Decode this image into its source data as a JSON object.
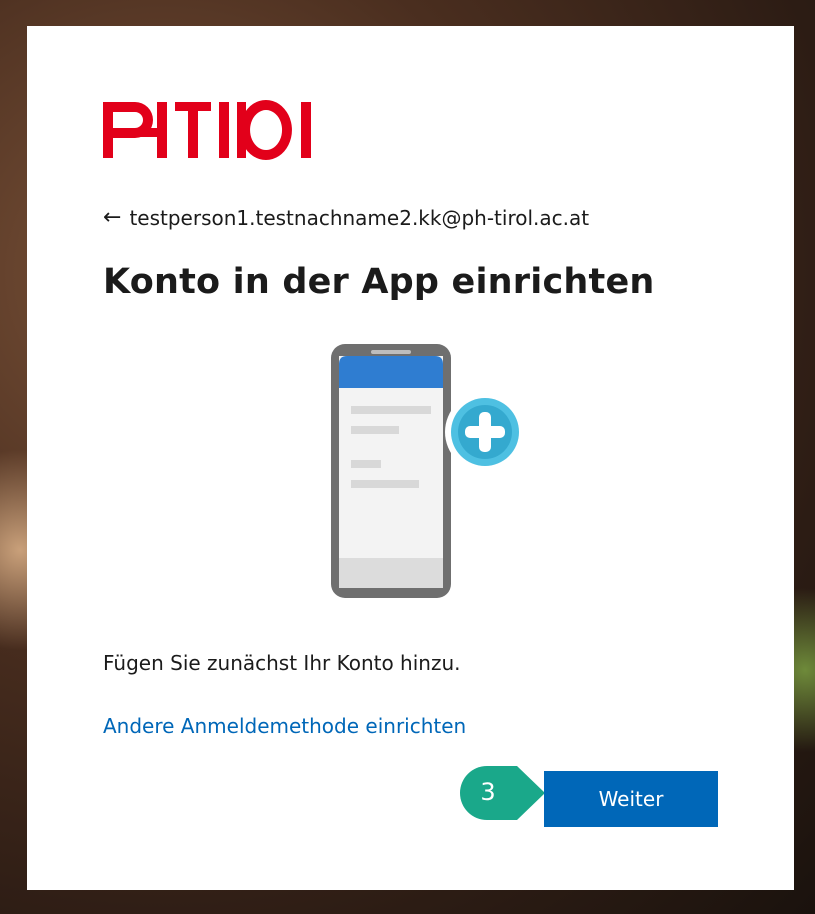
{
  "logo": {
    "alt": "PH Tirol",
    "color": "#e2001a"
  },
  "account": {
    "email": "testperson1.testnachname2.kk@ph-tirol.ac.at",
    "back_icon": "arrow-left-icon"
  },
  "page": {
    "title": "Konto in der App einrichten",
    "description": "Fügen Sie zunächst Ihr Konto hinzu.",
    "alt_method_link": "Andere Anmeldemethode einrichten"
  },
  "actions": {
    "next_label": "Weiter"
  },
  "annotation": {
    "step_number": "3",
    "color": "#1aa88a"
  },
  "colors": {
    "accent": "#0067b8",
    "text": "#1b1b1b",
    "background": "#ffffff"
  }
}
